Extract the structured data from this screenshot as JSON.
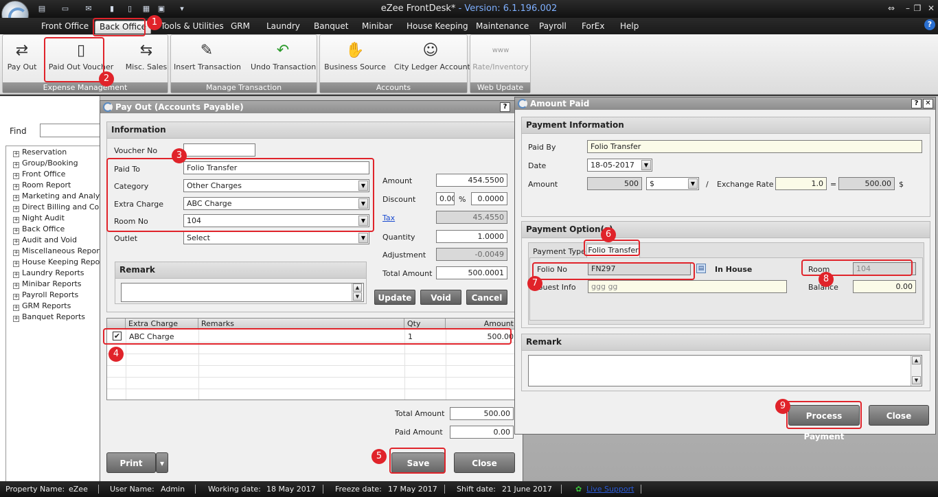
{
  "app": {
    "title": "eZee FrontDesk*",
    "version": " - Version: 6.1.196.002"
  },
  "menu": [
    "Front Office",
    "Back Office",
    "Tools & Utilities",
    "GRM",
    "Laundry",
    "Banquet",
    "Minibar",
    "House Keeping",
    "Maintenance",
    "Payroll",
    "ForEx",
    "Help"
  ],
  "ribbon": {
    "groups": [
      "Expense Management",
      "Manage Transaction",
      "Accounts",
      "Web Update"
    ],
    "buttons": [
      "Pay Out",
      "Paid Out Voucher",
      "Misc. Sales",
      "Insert Transaction",
      "Undo Transaction",
      "Business Source",
      "City Ledger Account",
      "Rate/Inventory"
    ],
    "www": "www"
  },
  "sidebar": {
    "find_label": "Find",
    "items": [
      "Reservation",
      "Group/Booking",
      "Front Office",
      "Room Report",
      "Marketing and Analysis",
      "Direct Billing and Company",
      "Night Audit",
      "Back Office",
      "Audit and Void",
      "Miscellaneous Report",
      "House Keeping Report",
      "Laundry Reports",
      "Minibar Reports",
      "Payroll Reports",
      "GRM Reports",
      "Banquet Reports"
    ]
  },
  "payout": {
    "title": "Pay Out (Accounts Payable)",
    "help": "?",
    "info_head": "Information",
    "voucher_label": "Voucher No",
    "voucher_value": "",
    "paid_to_label": "Paid To",
    "paid_to_value": "Folio Transfer",
    "category_label": "Category",
    "category_value": "Other Charges",
    "extra_label": "Extra Charge",
    "extra_value": "ABC Charge",
    "room_label": "Room No",
    "room_value": "104",
    "outlet_label": "Outlet",
    "outlet_value": "Select",
    "amount_label": "Amount",
    "amount_value": "454.5500",
    "discount_label": "Discount",
    "discount_pct": "0.00",
    "pct": "%",
    "discount_value": "0.0000",
    "tax_label": "Tax",
    "tax_value": "45.4550",
    "qty_label": "Quantity",
    "qty_value": "1.0000",
    "adj_label": "Adjustment",
    "adj_value": "-0.0049",
    "total_label": "Total Amount",
    "total_value": "500.0001",
    "remark_head": "Remark",
    "update": "Update",
    "void": "Void",
    "cancel": "Cancel",
    "grid_headers": [
      "Extra Charge",
      "Remarks",
      "Qty",
      "Amount"
    ],
    "row": {
      "checked": "✔",
      "charge": "ABC Charge",
      "remarks": "",
      "qty": "1",
      "amount": "500.00"
    },
    "total_amount_label": "Total Amount",
    "total_amount_value": "500.00",
    "paid_amount_label": "Paid Amount",
    "paid_amount_value": "0.00",
    "print": "Print",
    "save": "Save",
    "close": "Close"
  },
  "amount_paid": {
    "title": "Amount Paid",
    "help": "?",
    "close_x": "✕",
    "info_head": "Payment Information",
    "paid_by_label": "Paid By",
    "paid_by_value": "Folio Transfer",
    "date_label": "Date",
    "date_value": "18-05-2017",
    "amount_label": "Amount",
    "amount_value": "500",
    "currency": "$",
    "slash": "/",
    "rate_label": "Exchange Rate",
    "rate_value": "1.0",
    "equals": "=",
    "converted": "500.00",
    "converted_cur": "$",
    "options_head": "Payment Option(s)",
    "payment_type_label": "Payment Type",
    "payment_type_tab": "Folio Transfer",
    "folio_label": "Folio No",
    "folio_value": "FN297",
    "in_house": "In House",
    "guest_label": "Guest Info",
    "guest_value": "ggg gg",
    "room_label": "Room",
    "room_value": "104",
    "balance_label": "Balance",
    "balance_value": "0.00",
    "remark_head": "Remark",
    "process": "Process Payment",
    "close": "Close"
  },
  "badges": [
    "1",
    "2",
    "3",
    "4",
    "5",
    "6",
    "7",
    "8",
    "9"
  ],
  "status": {
    "property_label": "Property Name:",
    "property_value": "eZee",
    "user_label": "User Name:",
    "user_value": "Admin",
    "working_label": "Working date:",
    "working_value": "18 May 2017",
    "freeze_label": "Freeze date:",
    "freeze_value": "17 May 2017",
    "shift_label": "Shift date:",
    "shift_value": "21 June 2017",
    "live_support": "Live Support"
  },
  "colors": {
    "accent_red": "#e0232a",
    "link": "#1a4bd0"
  }
}
